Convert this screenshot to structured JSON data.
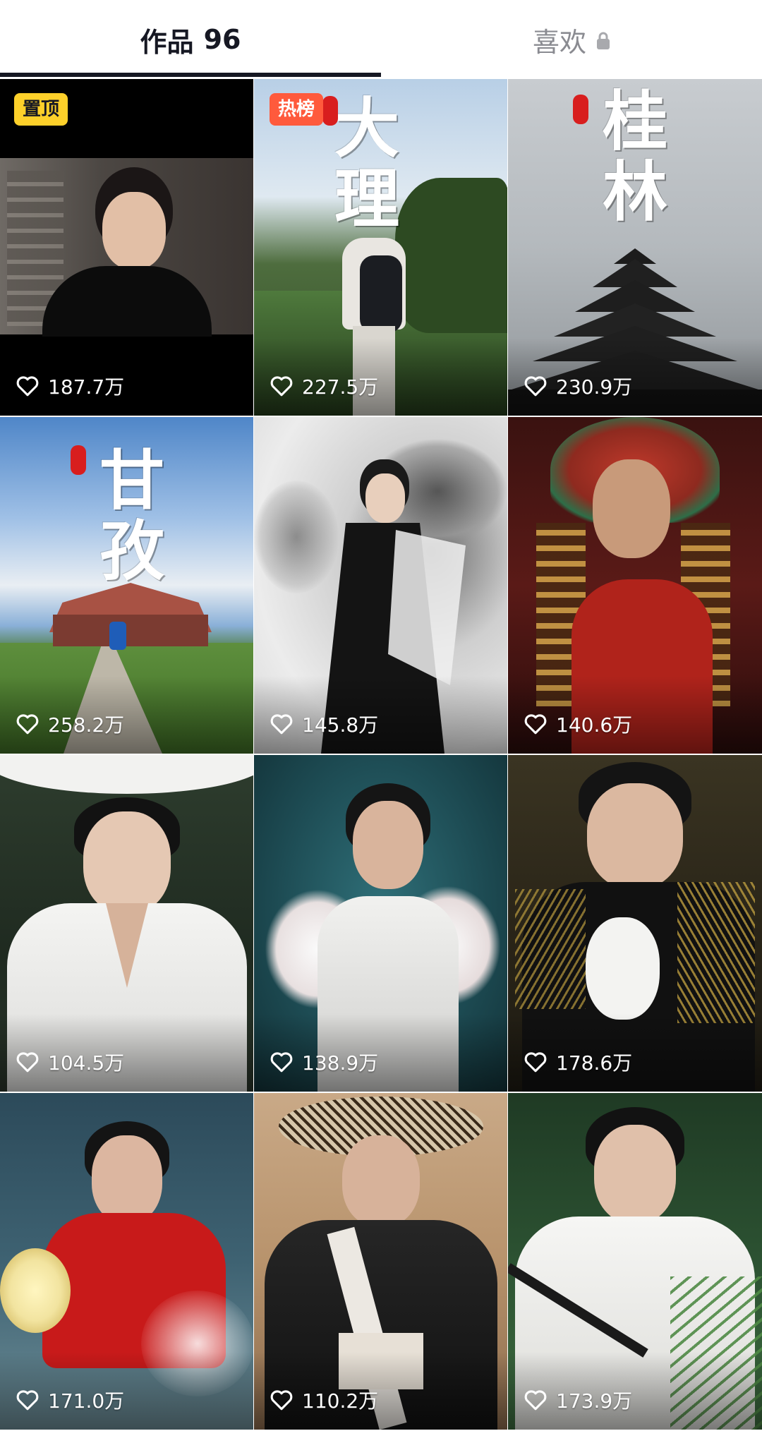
{
  "tabs": {
    "works_label": "作品",
    "works_count": "96",
    "likes_label": "喜欢"
  },
  "icons": {
    "heart": "heart-outline-icon",
    "lock": "lock-icon"
  },
  "badges": {
    "pinned": "置顶",
    "hot": "热榜"
  },
  "posts": [
    {
      "likes": "187.7万",
      "badge": "置顶"
    },
    {
      "likes": "227.5万",
      "badge": "热榜",
      "title": "大理"
    },
    {
      "likes": "230.9万",
      "title": "桂林"
    },
    {
      "likes": "258.2万",
      "title": "甘孜"
    },
    {
      "likes": "145.8万"
    },
    {
      "likes": "140.6万"
    },
    {
      "likes": "104.5万"
    },
    {
      "likes": "138.9万"
    },
    {
      "likes": "178.6万"
    },
    {
      "likes": "171.0万"
    },
    {
      "likes": "110.2万"
    },
    {
      "likes": "173.9万"
    }
  ],
  "colors": {
    "pinned_badge": "#fdd02a",
    "hot_badge": "#ff5a3c",
    "active_tab": "#161823",
    "inactive_tab": "#8a8b91"
  }
}
